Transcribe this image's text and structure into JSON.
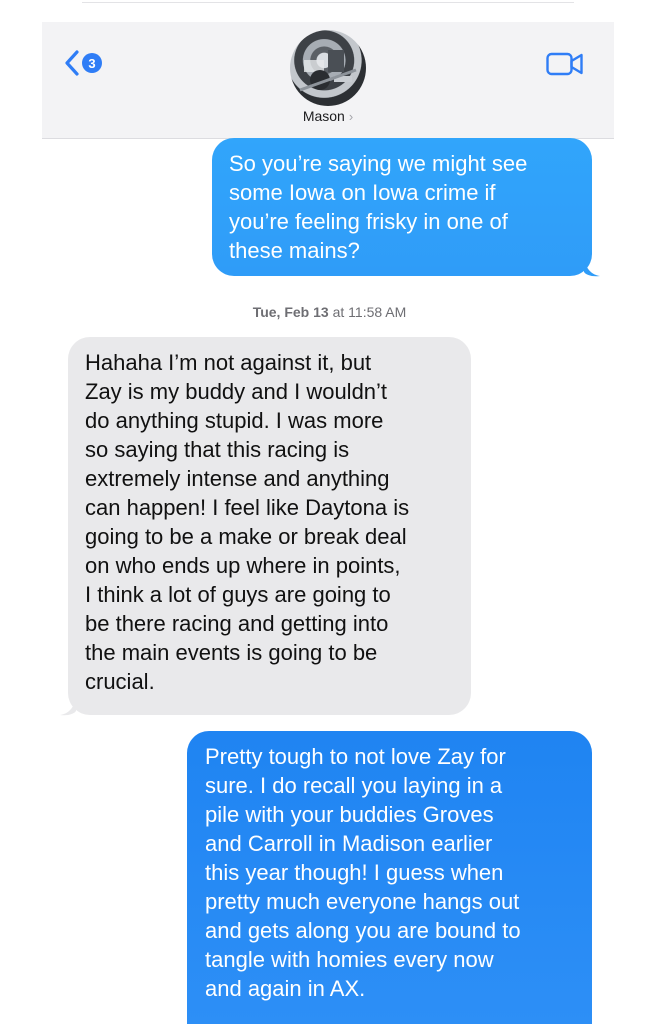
{
  "header": {
    "back_count": "3",
    "contact_name": "Mason",
    "name_chevron": "›"
  },
  "timestamp": {
    "day_date": "Tue, Feb 13",
    "at": "at",
    "time": "11:58 AM"
  },
  "messages": [
    {
      "direction": "sent",
      "text": "So you’re saying we might see\nsome Iowa on Iowa crime if\nyou’re feeling frisky in one of\nthese mains?"
    },
    {
      "direction": "received",
      "text": "Hahaha I’m not against it, but\nZay is my buddy and I wouldn’t\ndo anything stupid. I was more\nso saying that this racing is\nextremely intense and anything\ncan happen! I feel like Daytona is\ngoing to be a make or break deal\non who ends up where in points,\nI think a lot of guys are going to\nbe there racing and getting into\nthe main events is going to be\ncrucial."
    },
    {
      "direction": "sent",
      "text": "Pretty tough to not love Zay for\nsure. I do recall you laying in a\npile with your buddies Groves\nand Carroll in Madison earlier\nthis year though! I guess when\npretty much everyone hangs out\nand gets along you are bound to\ntangle with homies every now\nand again in AX."
    }
  ],
  "icons": {
    "back": "chevron-left-icon",
    "video": "video-camera-icon",
    "avatar": "contact-photo"
  },
  "colors": {
    "sent_bubble": "#2f9cf8",
    "received_bubble": "#e9e9eb",
    "accent": "#2f7df6"
  }
}
